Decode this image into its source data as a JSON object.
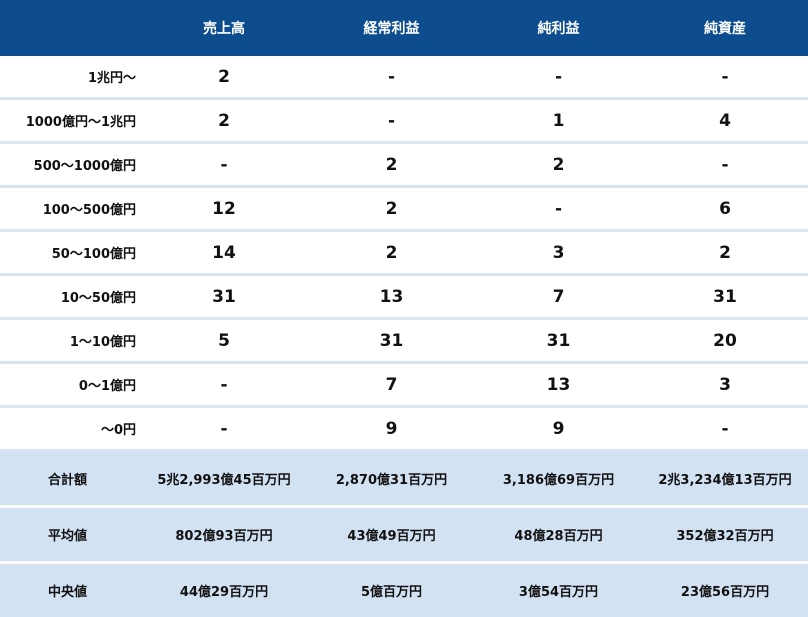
{
  "headers": [
    "",
    "売上高",
    "経常利益",
    "純利益",
    "純資産"
  ],
  "rows": [
    {
      "label": "1兆円～",
      "values": [
        "2",
        "-",
        "-",
        "-"
      ]
    },
    {
      "label": "1000億円～1兆円",
      "values": [
        "2",
        "-",
        "1",
        "4"
      ]
    },
    {
      "label": "500～1000億円",
      "values": [
        "-",
        "2",
        "2",
        "-"
      ]
    },
    {
      "label": "100～500億円",
      "values": [
        "12",
        "2",
        "-",
        "6"
      ]
    },
    {
      "label": "50～100億円",
      "values": [
        "14",
        "2",
        "3",
        "2"
      ]
    },
    {
      "label": "10～50億円",
      "values": [
        "31",
        "13",
        "7",
        "31"
      ]
    },
    {
      "label": "1～10億円",
      "values": [
        "5",
        "31",
        "31",
        "20"
      ]
    },
    {
      "label": "0～1億円",
      "values": [
        "-",
        "7",
        "13",
        "3"
      ]
    },
    {
      "label": "～0円",
      "values": [
        "-",
        "9",
        "9",
        "-"
      ]
    }
  ],
  "summary": [
    {
      "label": "合計額",
      "values": [
        "5兆2,993億45百万円",
        "2,870億31百万円",
        "3,186億69百万円",
        "2兆3,234億13百万円"
      ]
    },
    {
      "label": "平均値",
      "values": [
        "802億93百万円",
        "43億49百万円",
        "48億28百万円",
        "352億32百万円"
      ]
    },
    {
      "label": "中央値",
      "values": [
        "44億29百万円",
        "5億百万円",
        "3億54百万円",
        "23億56百万円"
      ]
    }
  ],
  "colors": {
    "header_bg": "#0d4d8e",
    "summary_bg": "#d2e2f3",
    "row_divider": "#d7e4f1"
  }
}
